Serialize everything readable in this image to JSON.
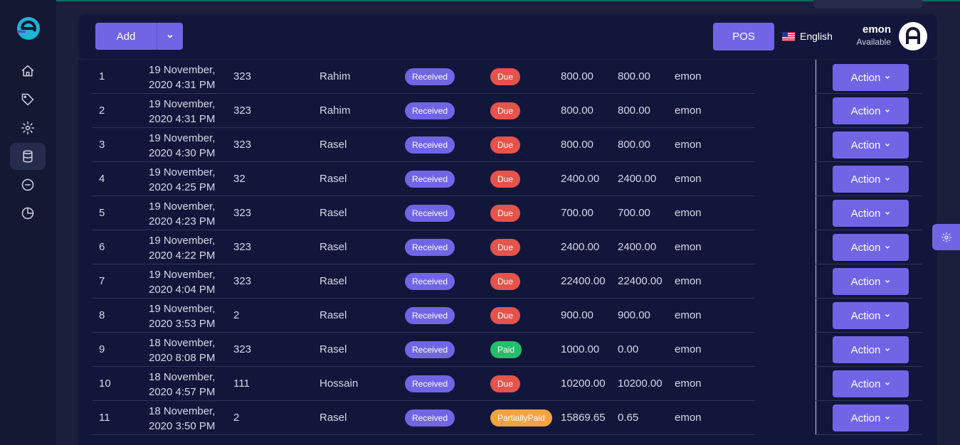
{
  "colors": {
    "accent": "#7165e6",
    "due": "#e5534b",
    "paid": "#1fbf6b",
    "partial": "#f5a341",
    "bg": "#1b1f3b",
    "panel": "#12163a"
  },
  "sidebar": {
    "items": [
      {
        "icon": "home-icon"
      },
      {
        "icon": "tag-icon"
      },
      {
        "icon": "gear-icon"
      },
      {
        "icon": "database-icon",
        "active": true
      },
      {
        "icon": "minus-circle-icon"
      },
      {
        "icon": "pie-chart-icon"
      }
    ]
  },
  "toolbar": {
    "add_label": "Add",
    "pos_label": "POS"
  },
  "language": {
    "label": "English"
  },
  "user": {
    "name": "emon",
    "status": "Available"
  },
  "table": {
    "action_label": "Action",
    "rows": [
      {
        "no": "1",
        "date": [
          "19 November,",
          "2020 4:31 PM"
        ],
        "ref": "323",
        "customer": "Rahim",
        "status": "Received",
        "payment": "Due",
        "payment_color": "#e5534b",
        "total": "800.00",
        "due": "800.00",
        "user": "emon"
      },
      {
        "no": "2",
        "date": [
          "19 November,",
          "2020 4:31 PM"
        ],
        "ref": "323",
        "customer": "Rahim",
        "status": "Received",
        "payment": "Due",
        "payment_color": "#e5534b",
        "total": "800.00",
        "due": "800.00",
        "user": "emon"
      },
      {
        "no": "3",
        "date": [
          "19 November,",
          "2020 4:30 PM"
        ],
        "ref": "323",
        "customer": "Rasel",
        "status": "Received",
        "payment": "Due",
        "payment_color": "#e5534b",
        "total": "800.00",
        "due": "800.00",
        "user": "emon"
      },
      {
        "no": "4",
        "date": [
          "19 November,",
          "2020 4:25 PM"
        ],
        "ref": "32",
        "customer": "Rasel",
        "status": "Received",
        "payment": "Due",
        "payment_color": "#e5534b",
        "total": "2400.00",
        "due": "2400.00",
        "user": "emon"
      },
      {
        "no": "5",
        "date": [
          "19 November,",
          "2020 4:23 PM"
        ],
        "ref": "323",
        "customer": "Rasel",
        "status": "Received",
        "payment": "Due",
        "payment_color": "#e5534b",
        "total": "700.00",
        "due": "700.00",
        "user": "emon"
      },
      {
        "no": "6",
        "date": [
          "19 November,",
          "2020 4:22 PM"
        ],
        "ref": "323",
        "customer": "Rasel",
        "status": "Received",
        "payment": "Due",
        "payment_color": "#e5534b",
        "total": "2400.00",
        "due": "2400.00",
        "user": "emon"
      },
      {
        "no": "7",
        "date": [
          "19 November,",
          "2020 4:04 PM"
        ],
        "ref": "323",
        "customer": "Rasel",
        "status": "Received",
        "payment": "Due",
        "payment_color": "#e5534b",
        "total": "22400.00",
        "due": "22400.00",
        "user": "emon"
      },
      {
        "no": "8",
        "date": [
          "19 November,",
          "2020 3:53 PM"
        ],
        "ref": "2",
        "customer": "Rasel",
        "status": "Received",
        "payment": "Due",
        "payment_color": "#e5534b",
        "total": "900.00",
        "due": "900.00",
        "user": "emon"
      },
      {
        "no": "9",
        "date": [
          "18 November,",
          "2020 8:08 PM"
        ],
        "ref": "323",
        "customer": "Rasel",
        "status": "Received",
        "payment": "Paid",
        "payment_color": "#1fbf6b",
        "total": "1000.00",
        "due": "0.00",
        "user": "emon"
      },
      {
        "no": "10",
        "date": [
          "18 November,",
          "2020 4:57 PM"
        ],
        "ref": "111",
        "customer": "Hossain",
        "status": "Received",
        "payment": "Due",
        "payment_color": "#e5534b",
        "total": "10200.00",
        "due": "10200.00",
        "user": "emon"
      },
      {
        "no": "11",
        "date": [
          "18 November,",
          "2020 3:50 PM"
        ],
        "ref": "2",
        "customer": "Rasel",
        "status": "Received",
        "payment": "PartiallyPaid",
        "payment_color": "#f5a341",
        "total": "15869.65",
        "due": "0.65",
        "user": "emon"
      }
    ]
  }
}
